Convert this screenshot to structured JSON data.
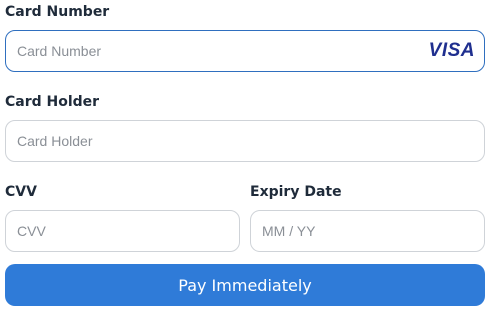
{
  "card_number": {
    "label": "Card Number",
    "placeholder": "Card Number",
    "value": "",
    "brand": "VISA"
  },
  "card_holder": {
    "label": "Card Holder",
    "placeholder": "Card Holder",
    "value": ""
  },
  "cvv": {
    "label": "CVV",
    "placeholder": "CVV",
    "value": ""
  },
  "expiry": {
    "label": "Expiry Date",
    "placeholder": "MM / YY",
    "value": ""
  },
  "submit": {
    "label": "Pay Immediately"
  },
  "colors": {
    "accent": "#2f7bd8",
    "focus_border": "#2f6fbf",
    "brand": "#1f2f8f"
  }
}
